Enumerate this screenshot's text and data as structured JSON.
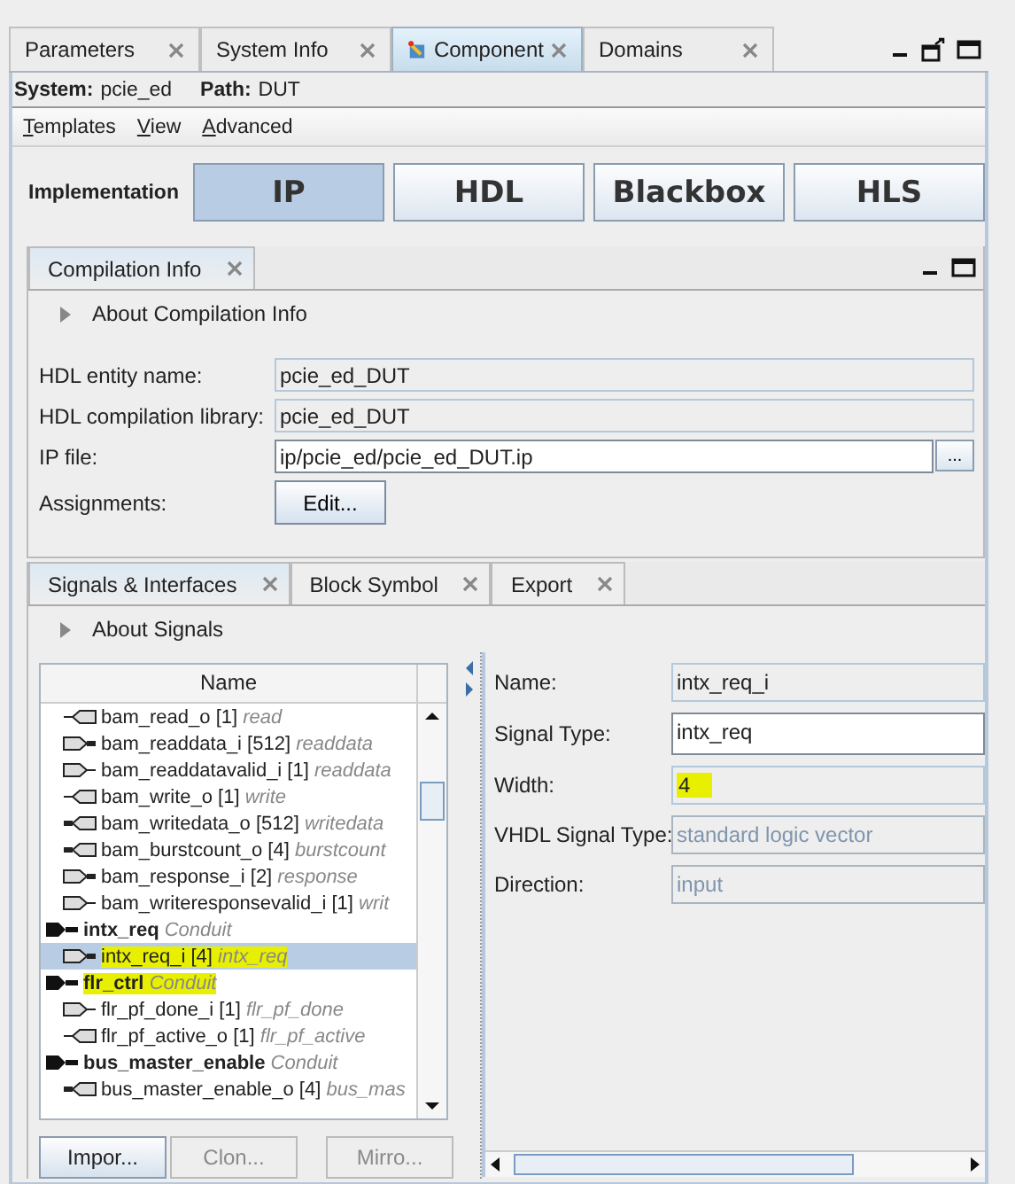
{
  "tabs": [
    {
      "label": "Parameters",
      "selected": false,
      "icon": false
    },
    {
      "label": "System Info",
      "selected": false,
      "icon": false
    },
    {
      "label": "Component",
      "selected": true,
      "icon": true
    },
    {
      "label": "Domains",
      "selected": false,
      "icon": false
    }
  ],
  "context": {
    "system_label": "System:",
    "system": "pcie_ed",
    "path_label": "Path:",
    "path": "DUT"
  },
  "menu": [
    "Templates",
    "View",
    "Advanced"
  ],
  "implementation": {
    "label": "Implementation",
    "options": [
      {
        "label": "IP",
        "selected": true
      },
      {
        "label": "HDL",
        "selected": false
      },
      {
        "label": "Blackbox",
        "selected": false
      },
      {
        "label": "HLS",
        "selected": false
      }
    ]
  },
  "compilation": {
    "tab": "Compilation Info",
    "about": "About Compilation Info",
    "fields": [
      {
        "kind": "readonly",
        "label": "HDL entity name:",
        "value": "pcie_ed_DUT"
      },
      {
        "kind": "readonly",
        "label": "HDL compilation library:",
        "value": "pcie_ed_DUT"
      },
      {
        "kind": "browse",
        "label": "IP file:",
        "value": "ip/pcie_ed/pcie_ed_DUT.ip",
        "button": "..."
      },
      {
        "kind": "button",
        "label": "Assignments:",
        "button": "Edit..."
      }
    ]
  },
  "signals": {
    "tabs": [
      {
        "label": "Signals & Interfaces",
        "selected": true
      },
      {
        "label": "Block Symbol",
        "selected": false
      },
      {
        "label": "Export",
        "selected": false
      }
    ],
    "about": "About Signals",
    "column": "Name",
    "tree": [
      {
        "kind": "port",
        "name": "bam_read_o [1]",
        "role": "read",
        "input": false,
        "bus": false,
        "selected": false,
        "highlight": false
      },
      {
        "kind": "port",
        "name": "bam_readdata_i [512]",
        "role": "readdata",
        "input": true,
        "bus": true,
        "selected": false,
        "highlight": false
      },
      {
        "kind": "port",
        "name": "bam_readdatavalid_i [1]",
        "role": "readdata",
        "input": true,
        "bus": false,
        "selected": false,
        "highlight": false
      },
      {
        "kind": "port",
        "name": "bam_write_o [1]",
        "role": "write",
        "input": false,
        "bus": false,
        "selected": false,
        "highlight": false
      },
      {
        "kind": "port",
        "name": "bam_writedata_o [512]",
        "role": "writedata",
        "input": false,
        "bus": true,
        "selected": false,
        "highlight": false
      },
      {
        "kind": "port",
        "name": "bam_burstcount_o [4]",
        "role": "burstcount",
        "input": false,
        "bus": true,
        "selected": false,
        "highlight": false
      },
      {
        "kind": "port",
        "name": "bam_response_i [2]",
        "role": "response",
        "input": true,
        "bus": true,
        "selected": false,
        "highlight": false
      },
      {
        "kind": "port",
        "name": "bam_writeresponsevalid_i [1]",
        "role": "writ",
        "input": true,
        "bus": false,
        "selected": false,
        "highlight": false
      },
      {
        "kind": "interface",
        "name": "intx_req",
        "role": "Conduit",
        "selected": false,
        "highlight": false,
        "children": [
          {
            "kind": "port",
            "name": "intx_req_i [4]",
            "role": "intx_req",
            "input": true,
            "bus": true,
            "selected": true,
            "highlight": true
          }
        ]
      },
      {
        "kind": "interface",
        "name": "flr_ctrl",
        "role": "Conduit",
        "selected": false,
        "highlight": true,
        "children": [
          {
            "kind": "port",
            "name": "flr_pf_done_i [1]",
            "role": "flr_pf_done",
            "input": true,
            "bus": false,
            "selected": false,
            "highlight": false
          },
          {
            "kind": "port",
            "name": "flr_pf_active_o [1]",
            "role": "flr_pf_active",
            "input": false,
            "bus": false,
            "selected": false,
            "highlight": false
          }
        ]
      },
      {
        "kind": "interface",
        "name": "bus_master_enable",
        "role": "Conduit",
        "selected": false,
        "highlight": false,
        "children": [
          {
            "kind": "port",
            "name": "bus_master_enable_o [4]",
            "role": "bus_mas",
            "input": false,
            "bus": true,
            "selected": false,
            "highlight": false
          }
        ]
      }
    ],
    "buttons": [
      {
        "label": "Impor...",
        "disabled": false
      },
      {
        "label": "Clon...",
        "disabled": true
      },
      {
        "label": "Mirro...",
        "disabled": true
      }
    ],
    "details": [
      {
        "label": "Name:",
        "value": "intx_req_i",
        "kind": "readonly",
        "highlight": false
      },
      {
        "label": "Signal Type:",
        "value": "intx_req",
        "kind": "editable",
        "highlight": false
      },
      {
        "label": "Width:",
        "value": "4",
        "kind": "readonly",
        "highlight": true
      },
      {
        "label": "VHDL Signal Type:",
        "value": "standard logic vector",
        "kind": "disabled",
        "highlight": false
      },
      {
        "label": "Direction:",
        "value": "input",
        "kind": "disabled",
        "highlight": false
      }
    ]
  }
}
